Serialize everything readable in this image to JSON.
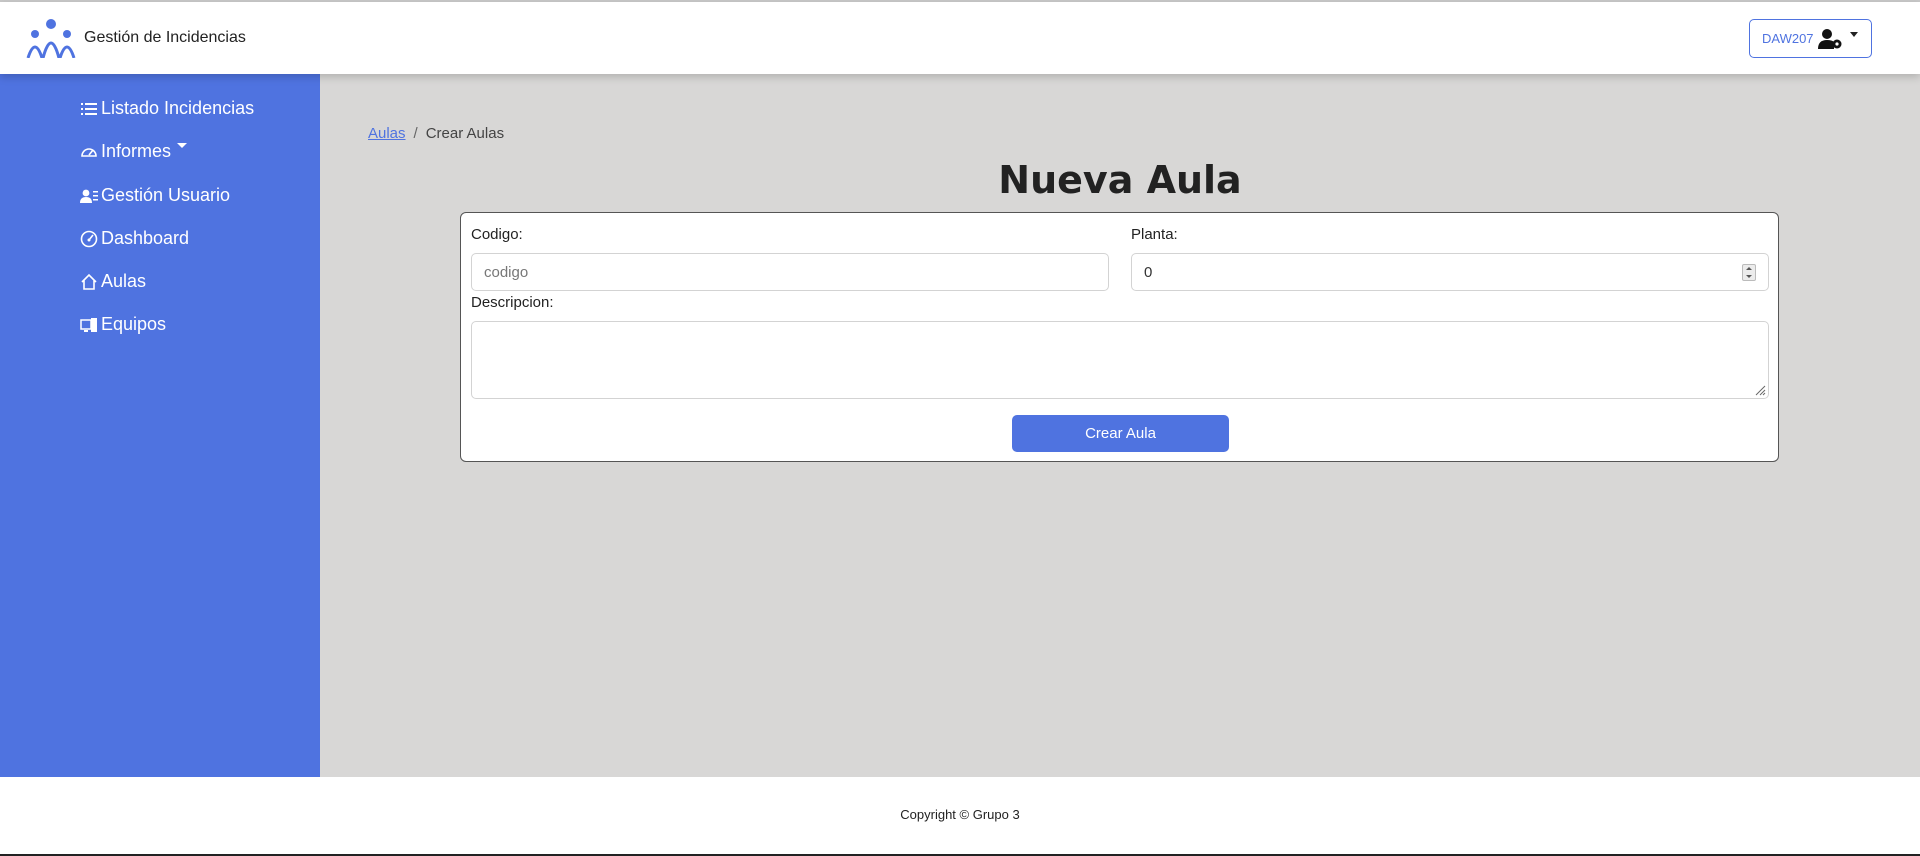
{
  "header": {
    "brand": "Gestión de Incidencias",
    "user_label": "DAW207",
    "logo_icon": "people-group-icon",
    "user_icon": "user-gear-icon"
  },
  "sidebar": {
    "items": [
      {
        "label": "Listado Incidencias",
        "icon": "list-icon"
      },
      {
        "label": "Informes",
        "icon": "speedometer-icon"
      },
      {
        "label": "Gestión Usuario",
        "icon": "user-list-icon"
      },
      {
        "label": "Dashboard",
        "icon": "dashboard-gauge-icon"
      },
      {
        "label": "Aulas",
        "icon": "house-icon"
      },
      {
        "label": "Equipos",
        "icon": "devices-icon"
      }
    ]
  },
  "breadcrumb": {
    "link": "Aulas",
    "separator": "/",
    "current": "Crear Aulas"
  },
  "page": {
    "title": "Nueva Aula"
  },
  "form": {
    "codigo_label": "Codigo:",
    "codigo_placeholder": "codigo",
    "planta_label": "Planta:",
    "planta_value": "0",
    "descripcion_label": "Descripcion:",
    "descripcion_value": "",
    "submit_label": "Crear Aula"
  },
  "footer": {
    "copyright": "Copyright © Grupo 3"
  },
  "colors": {
    "accent": "#4f73e0",
    "main_bg": "#d8d7d6"
  }
}
